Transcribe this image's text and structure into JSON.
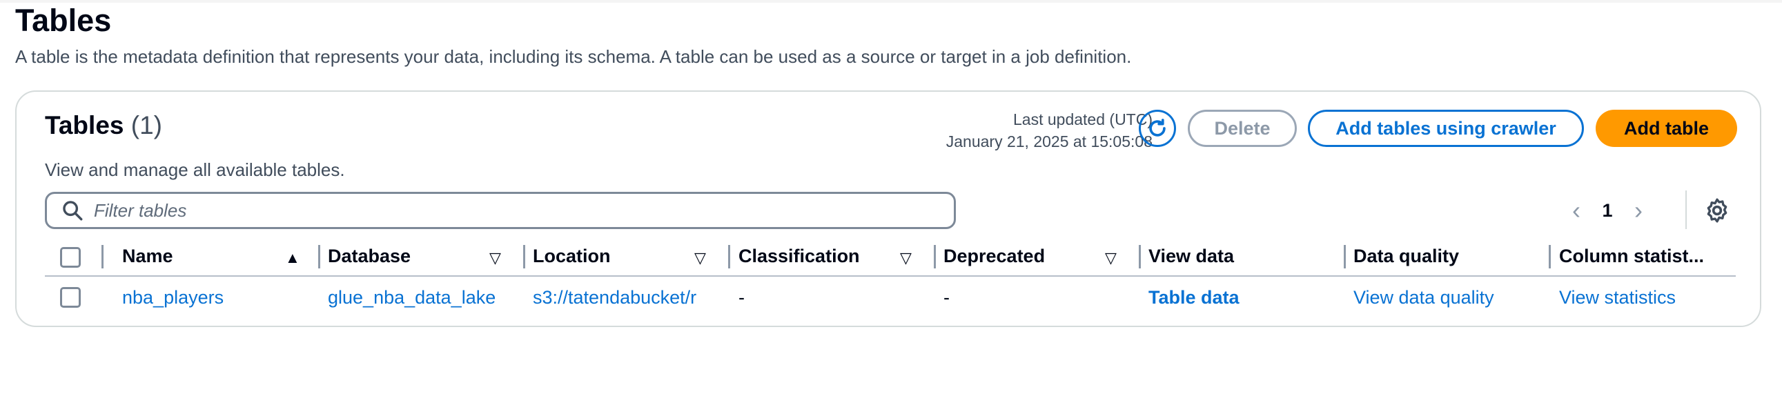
{
  "page": {
    "title": "Tables",
    "description": "A table is the metadata definition that represents your data, including its schema. A table can be used as a source or target in a job definition."
  },
  "panel": {
    "title": "Tables",
    "count": "(1)",
    "description": "View and manage all available tables.",
    "last_updated_label": "Last updated (UTC)",
    "last_updated_value": "January 21, 2025 at 15:05:08",
    "buttons": {
      "delete": "Delete",
      "add_crawler": "Add tables using crawler",
      "add_table": "Add table"
    },
    "filter_placeholder": "Filter tables",
    "current_page": "1"
  },
  "columns": {
    "name": "Name",
    "database": "Database",
    "location": "Location",
    "classification": "Classification",
    "deprecated": "Deprecated",
    "view_data": "View data",
    "data_quality": "Data quality",
    "column_statistics": "Column statist..."
  },
  "rows": [
    {
      "name": "nba_players",
      "database": "glue_nba_data_lake",
      "location": "s3://tatendabucket/r",
      "classification": "-",
      "deprecated": "-",
      "view_data": "Table data",
      "data_quality": "View data quality",
      "column_statistics": "View statistics"
    }
  ],
  "icons": {
    "refresh": "refresh-icon",
    "search": "search-icon",
    "settings": "gear-icon",
    "prev": "chevron-left-icon",
    "next": "chevron-right-icon"
  },
  "colors": {
    "link": "#0972d3",
    "primary_button": "#ff9900",
    "text": "#000716",
    "muted": "#414d5c"
  }
}
